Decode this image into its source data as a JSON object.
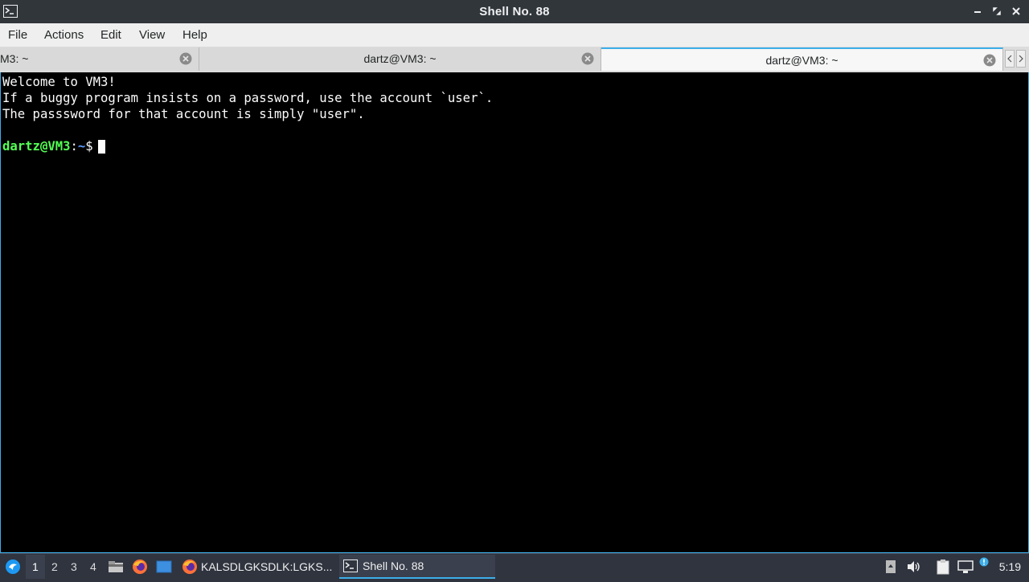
{
  "window": {
    "title": "Shell No. 88"
  },
  "menu": [
    "File",
    "Actions",
    "Edit",
    "View",
    "Help"
  ],
  "tabs": [
    {
      "label": "M3: ~",
      "active": false
    },
    {
      "label": "dartz@VM3: ~",
      "active": false
    },
    {
      "label": "dartz@VM3: ~",
      "active": true
    }
  ],
  "terminal": {
    "lines": [
      "Welcome to VM3!",
      "If a buggy program insists on a password, use the account `user`.",
      "The passsword for that account is simply \"user\".",
      ""
    ],
    "prompt": {
      "user_host": "dartz@VM3",
      "colon": ":",
      "path": "~",
      "symbol": "$"
    }
  },
  "taskbar": {
    "desktops": [
      "1",
      "2",
      "3",
      "4"
    ],
    "active_desktop": "1",
    "tasks": [
      {
        "label": "KALSDLGKSDLK:LGKS...",
        "icon": "firefox-icon",
        "active": false
      },
      {
        "label": "Shell No. 88",
        "icon": "terminal-icon",
        "active": true
      }
    ],
    "clock": "5:19"
  },
  "colors": {
    "accent": "#3daee9",
    "prompt_user": "#54ff54",
    "prompt_path": "#5c9cff",
    "terminal_bg": "#000000"
  }
}
